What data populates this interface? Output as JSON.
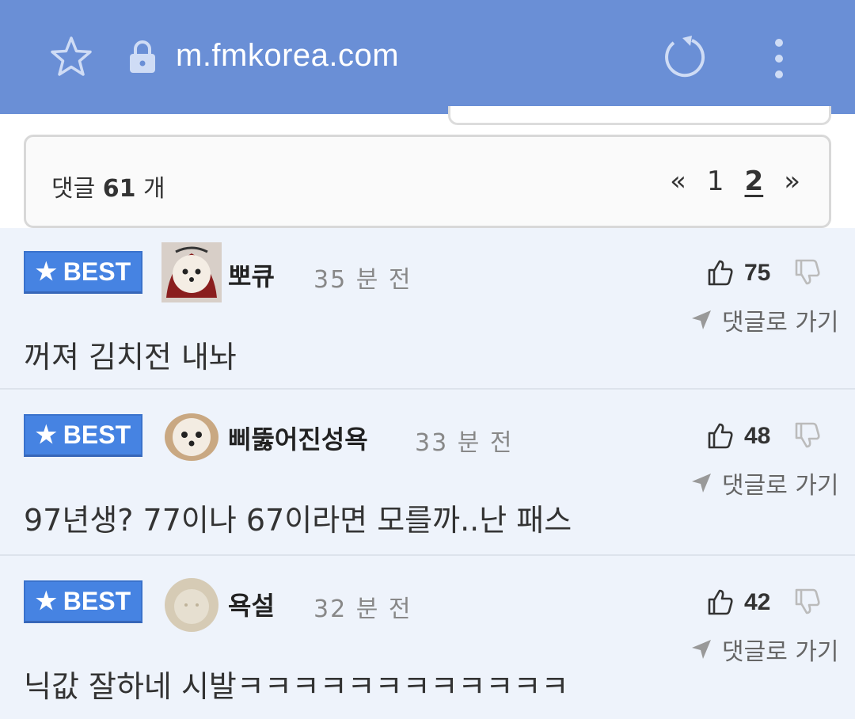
{
  "browser": {
    "url": "m.fmkorea.com"
  },
  "comments_header": {
    "label_prefix": "댓글",
    "count": "61",
    "label_suffix": "개",
    "pager": {
      "first": "«",
      "page1": "1",
      "page2": "2",
      "last": "»"
    }
  },
  "comments": [
    {
      "badge": "BEST",
      "username": "뽀큐",
      "time": "35 분 전",
      "likes": "75",
      "goto": "댓글로 가기",
      "text": "꺼져 김치전 내놔"
    },
    {
      "badge": "BEST",
      "username": "삐뚫어진성욕",
      "time": "33 분 전",
      "likes": "48",
      "goto": "댓글로 가기",
      "text": "97년생? 77이나 67이라면 모를까..난 패스"
    },
    {
      "badge": "BEST",
      "username": "욕설",
      "time": "32 분 전",
      "likes": "42",
      "goto": "댓글로 가기",
      "text": "닉값 잘하네 시발ㅋㅋㅋㅋㅋㅋㅋㅋㅋㅋㅋㅋ"
    }
  ],
  "colors": {
    "browser_bar": "#6a8fd6",
    "best_badge": "#4683e2",
    "comment_bg": "#eef3fb"
  }
}
